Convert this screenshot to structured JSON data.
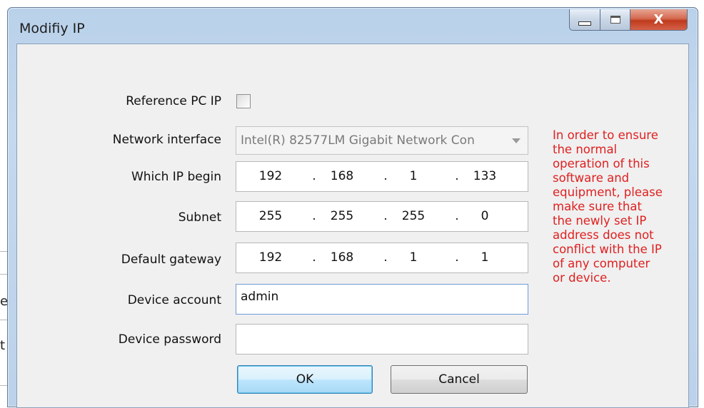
{
  "background": {
    "edge_chars": [
      "e",
      "t"
    ]
  },
  "window": {
    "title": "Modifiy IP",
    "close_glyph": "X"
  },
  "form": {
    "reference_pc_ip": {
      "label": "Reference PC IP",
      "checked": false
    },
    "network_interface": {
      "label": "Network interface",
      "value": "Intel(R) 82577LM Gigabit Network Con"
    },
    "which_ip_begin": {
      "label": "Which IP begin",
      "octets": [
        "192",
        "168",
        "1",
        "133"
      ]
    },
    "subnet": {
      "label": "Subnet",
      "octets": [
        "255",
        "255",
        "255",
        "0"
      ]
    },
    "default_gateway": {
      "label": "Default gateway",
      "octets": [
        "192",
        "168",
        "1",
        "1"
      ]
    },
    "device_account": {
      "label": "Device account",
      "value": "admin"
    },
    "device_password": {
      "label": "Device password",
      "value": ""
    },
    "ok_label": "OK",
    "cancel_label": "Cancel"
  },
  "note": {
    "lines": [
      "In order to ensure",
      "the normal",
      "operation of this",
      "software and",
      "equipment, please",
      "make sure that",
      "the newly set IP",
      "address does not",
      "conflict with the IP",
      "of any computer",
      "or device."
    ],
    "color": "#e02020"
  }
}
